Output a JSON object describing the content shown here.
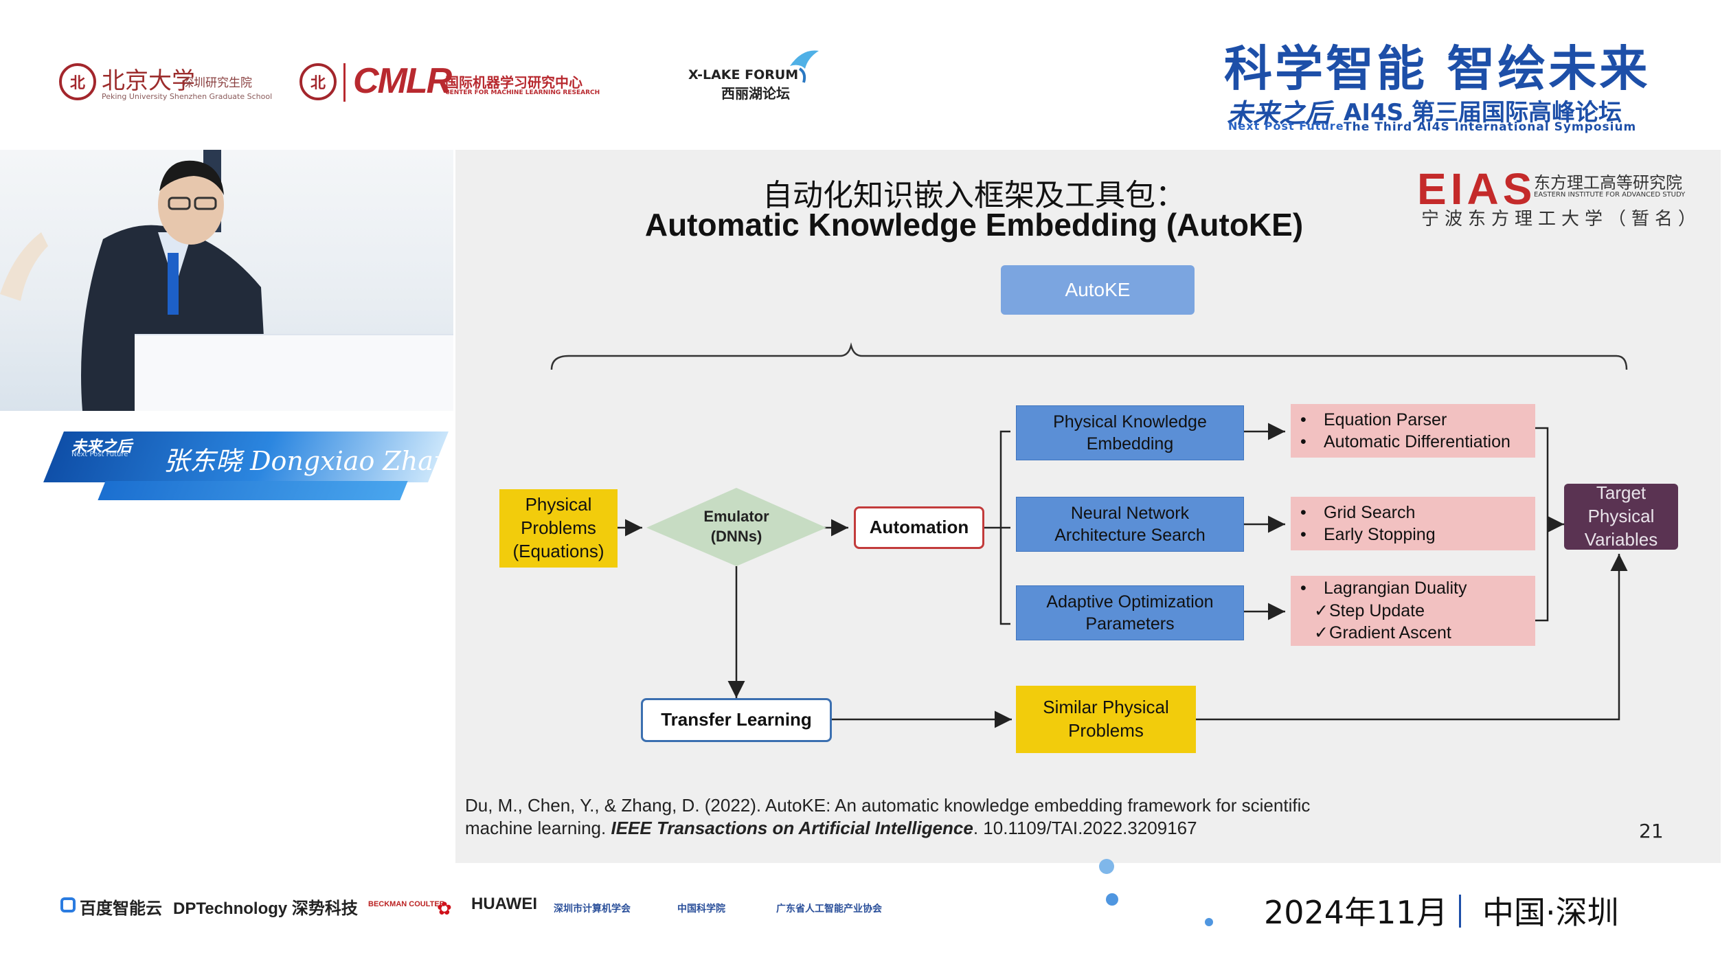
{
  "header": {
    "pku_logo_text": "北京大学",
    "pku_logo_text2": "深圳研究生院",
    "pku_logo_en": "Peking University Shenzhen Graduate School",
    "cmlr_mark": "CMLR",
    "cmlr_cn": "国际机器学习研究中心",
    "cmlr_en": "CENTER FOR MACHINE LEARNING RESEARCH",
    "xlake_en": "X-LAKE FORUM",
    "xlake_cn": "西丽湖论坛",
    "hero_title": "科学智能 智绘未来",
    "future_logo": "未来之后",
    "future_en": "Next Post Future",
    "forum_cn": "AI4S 第三届国际高峰论坛",
    "forum_en": "The Third AI4S International Symposium"
  },
  "speaker": {
    "logo": "未来之后",
    "logo_en": "Next Post Future",
    "name": "张东晓 Dongxiao Zhang"
  },
  "slide": {
    "title_cn": "自动化知识嵌入框架及工具包：",
    "title_en": "Automatic Knowledge Embedding (AutoKE)",
    "institute_mark": "EIAS",
    "institute_cn": "东方理工高等研究院",
    "institute_en": "EASTERN INSTITUTE FOR ADVANCED STUDY",
    "institute_sub": "宁波东方理工大学（暂名）",
    "diagram": {
      "autoke": "AutoKE",
      "physical_problems": [
        "Physical",
        "Problems",
        "(Equations)"
      ],
      "emulator": [
        "Emulator",
        "(DNNs)"
      ],
      "automation": "Automation",
      "pke": [
        "Physical Knowledge",
        "Embedding"
      ],
      "nas": [
        "Neural Network",
        "Architecture Search"
      ],
      "aop": [
        "Adaptive Optimization",
        "Parameters"
      ],
      "list1": [
        "Equation Parser",
        "Automatic Differentiation"
      ],
      "list2": [
        "Grid Search",
        "Early Stopping"
      ],
      "list3": [
        "Lagrangian Duality",
        "Step Update",
        "Gradient Ascent"
      ],
      "bullet": "•",
      "check": "✓",
      "target": [
        "Target",
        "Physical",
        "Variables"
      ],
      "transfer": "Transfer Learning",
      "similar": [
        "Similar Physical",
        "Problems"
      ]
    },
    "citation_line1": "Du, M., Chen, Y., & Zhang, D. (2022). AutoKE: An automatic knowledge embedding framework for scientific",
    "citation_line2_a": "machine learning. ",
    "citation_journal": "IEEE Transactions on Artificial Intelligence",
    "citation_line2_b": ". 10.1109/TAI.2022.3209167",
    "page_number": "21"
  },
  "footer": {
    "sponsors": [
      "百度智能云",
      "DPTechnology 深势科技",
      "BECKMAN COULTER",
      "HUAWEI",
      "深圳市计算机学会",
      "中国科学院",
      "广东省人工智能产业协会"
    ],
    "date": "2024年11月",
    "city": "中国·深圳"
  },
  "colors": {
    "brand_blue": "#1d4fa8",
    "box_blue": "#5b8fd6",
    "box_pink": "#f2c1c1",
    "box_yellow": "#f2cc0c",
    "box_dark": "#5a3352",
    "pku_red": "#a3262c"
  }
}
